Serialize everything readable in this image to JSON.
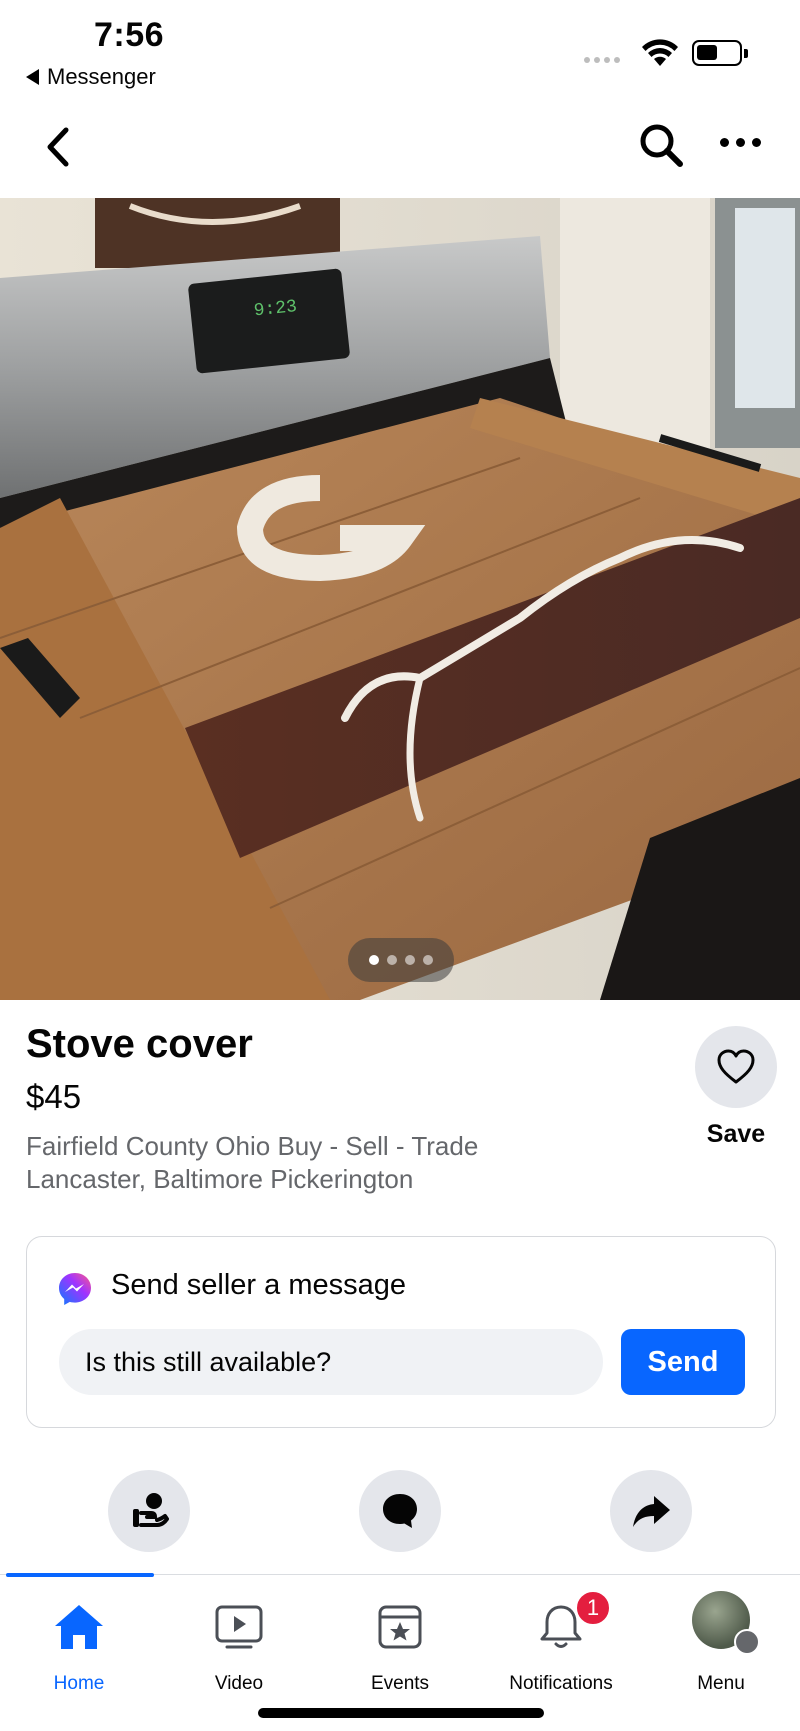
{
  "status_bar": {
    "time": "7:56",
    "back_app": "Messenger"
  },
  "listing": {
    "title": "Stove cover",
    "price": "$45",
    "group_line1": "Fairfield County Ohio Buy - Sell - Trade",
    "group_line2": "Lancaster, Baltimore Pickerington",
    "save_label": "Save",
    "image_count": 4,
    "active_image_index": 0
  },
  "message": {
    "heading": "Send seller a message",
    "input_value": "Is this still available?",
    "send_label": "Send"
  },
  "tabs": [
    {
      "label": "Home",
      "icon": "home-icon",
      "active": true
    },
    {
      "label": "Video",
      "icon": "video-icon",
      "active": false
    },
    {
      "label": "Events",
      "icon": "events-icon",
      "active": false
    },
    {
      "label": "Notifications",
      "icon": "bell-icon",
      "active": false,
      "badge": "1"
    },
    {
      "label": "Menu",
      "icon": "avatar",
      "active": false
    }
  ],
  "colors": {
    "accent": "#0866ff",
    "badge": "#e41e3f",
    "secondary_text": "#65676b"
  }
}
